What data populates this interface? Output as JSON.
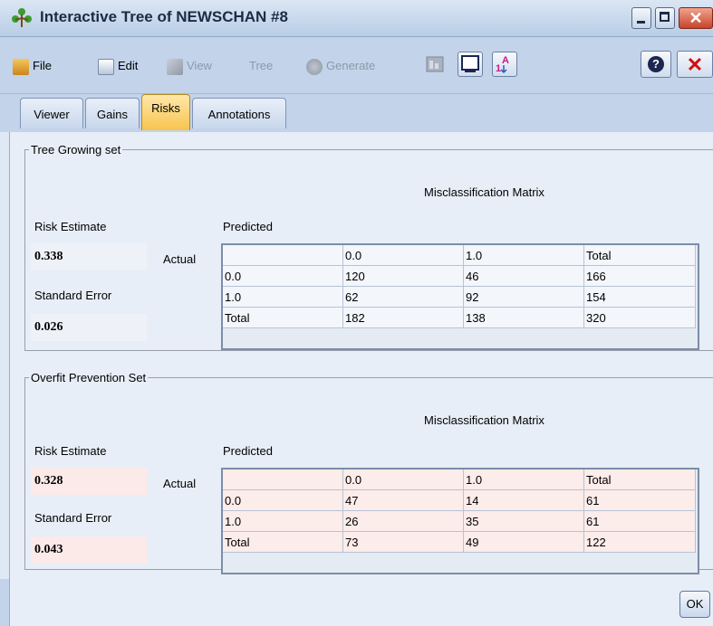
{
  "window": {
    "title": "Interactive Tree of NEWSCHAN #8",
    "title_icon": "tree-icon",
    "close_color": "#c8432b"
  },
  "menu": {
    "file": "File",
    "edit": "Edit",
    "view": "View",
    "tree": "Tree",
    "generate": "Generate"
  },
  "tabs": [
    {
      "label": "Viewer"
    },
    {
      "label": "Gains"
    },
    {
      "label": "Risks",
      "active": true
    },
    {
      "label": "Annotations"
    }
  ],
  "tree_growing": {
    "legend": "Tree Growing set",
    "matrix_title": "Misclassification Matrix",
    "risk_label": "Risk Estimate",
    "risk_value": "0.338",
    "se_label": "Standard Error",
    "se_value": "0.026",
    "predicted_label": "Predicted",
    "actual_label": "Actual",
    "rows": [
      [
        "",
        "0.0",
        "1.0",
        "Total"
      ],
      [
        "0.0",
        "120",
        "46",
        "166"
      ],
      [
        "1.0",
        "62",
        "92",
        "154"
      ],
      [
        "Total",
        "182",
        "138",
        "320"
      ]
    ]
  },
  "overfit": {
    "legend": "Overfit Prevention Set",
    "matrix_title": "Misclassification Matrix",
    "risk_label": "Risk Estimate",
    "risk_value": "0.328",
    "se_label": "Standard Error",
    "se_value": "0.043",
    "predicted_label": "Predicted",
    "actual_label": "Actual",
    "rows": [
      [
        "",
        "0.0",
        "1.0",
        "Total"
      ],
      [
        "0.0",
        "47",
        "14",
        "61"
      ],
      [
        "1.0",
        "26",
        "35",
        "61"
      ],
      [
        "Total",
        "73",
        "49",
        "122"
      ]
    ]
  },
  "footer": {
    "ok_label": "OK"
  }
}
